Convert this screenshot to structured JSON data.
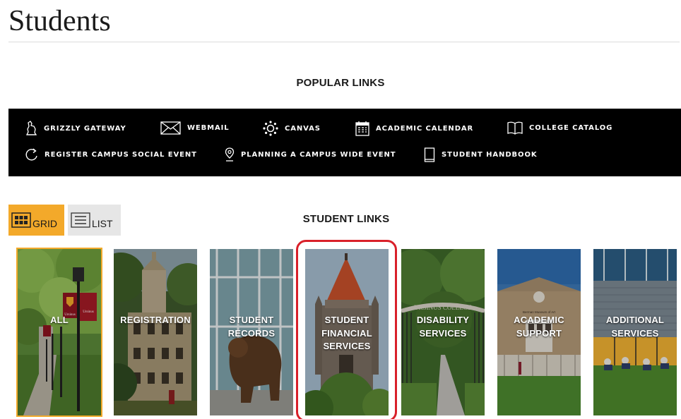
{
  "page": {
    "title": "Students"
  },
  "popular_links": {
    "heading": "POPULAR LINKS",
    "items": [
      {
        "label": "GRIZZLY GATEWAY",
        "icon": "bear-icon"
      },
      {
        "label": "WEBMAIL",
        "icon": "envelope-icon"
      },
      {
        "label": "CANVAS",
        "icon": "canvas-icon"
      },
      {
        "label": "ACADEMIC CALENDAR",
        "icon": "calendar-icon"
      },
      {
        "label": "COLLEGE CATALOG",
        "icon": "open-book-icon"
      },
      {
        "label": "REGISTER CAMPUS SOCIAL EVENT",
        "icon": "refresh-icon"
      },
      {
        "label": "PLANNING A CAMPUS WIDE EVENT",
        "icon": "map-pin-icon"
      },
      {
        "label": "STUDENT HANDBOOK",
        "icon": "book-icon"
      }
    ]
  },
  "view_toggle": {
    "grid_label": "GRID",
    "list_label": "LIST",
    "selected": "GRID"
  },
  "student_links": {
    "heading": "STUDENT LINKS",
    "tiles": [
      {
        "label": "ALL",
        "selected": true
      },
      {
        "label": "REGISTRATION"
      },
      {
        "label": "STUDENT RECORDS"
      },
      {
        "label": "STUDENT FINANCIAL SERVICES",
        "highlighted": true
      },
      {
        "label": "DISABILITY SERVICES"
      },
      {
        "label": "ACADEMIC SUPPORT"
      },
      {
        "label": "ADDITIONAL SERVICES"
      }
    ],
    "photo_text": {
      "banner": "Ursinus",
      "arch": "URSINUS COLLEGE",
      "museum_sign": "Berman Museum of Art"
    }
  },
  "colors": {
    "accent": "#f3a92a",
    "popular_bar": "#000000",
    "highlight": "#d9202a",
    "list_button": "#e6e6e6"
  }
}
